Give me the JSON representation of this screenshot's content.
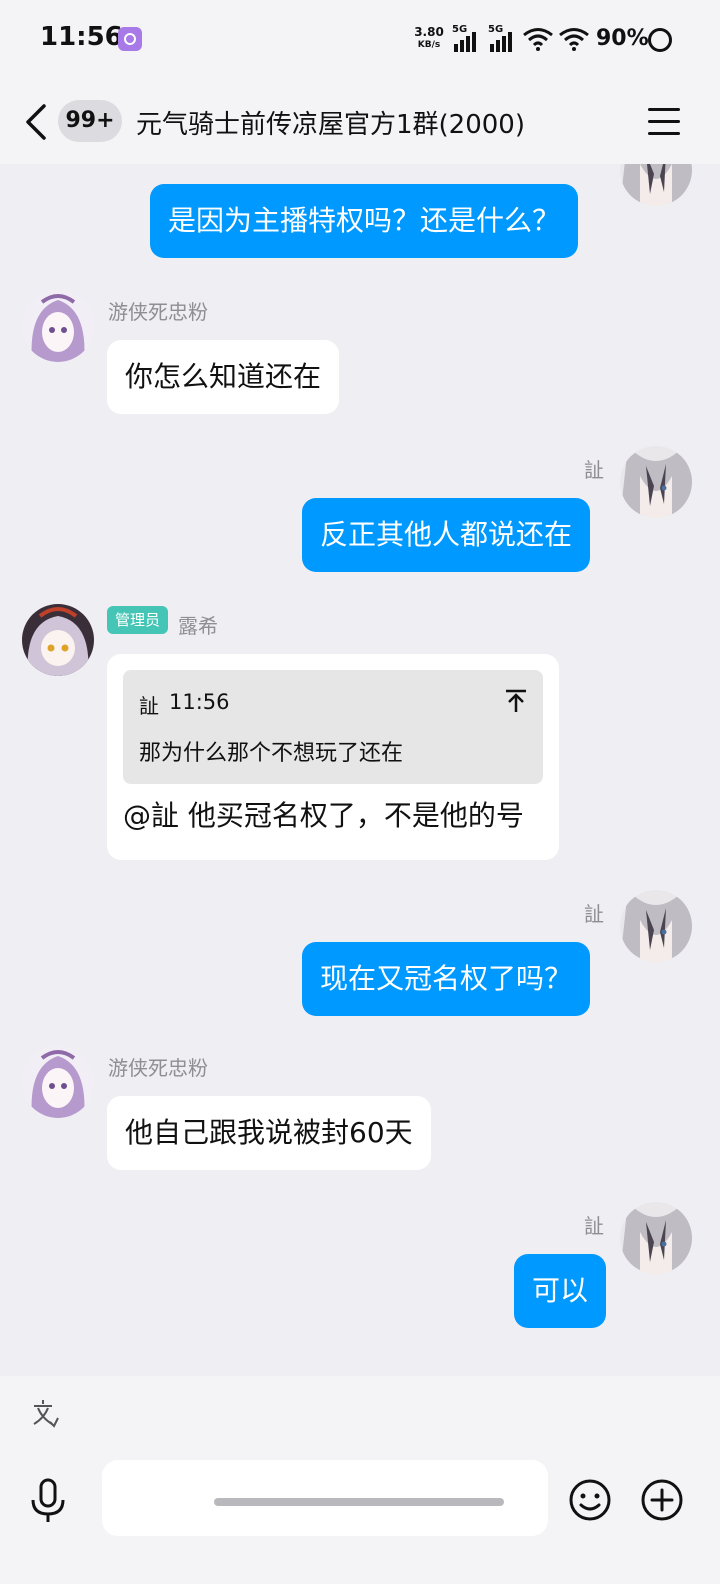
{
  "status_bar": {
    "time": "11:56",
    "net_speed": "3.80",
    "net_unit": "KB/s",
    "sim1": "5G",
    "sim2": "5G",
    "battery": "90%"
  },
  "header": {
    "unread": "99+",
    "title": "元气骑士前传凉屋官方1群(2000)"
  },
  "messages": [
    {
      "side": "me",
      "text": "是因为主播特权吗？还是什么？"
    },
    {
      "side": "them",
      "sender": "游侠死忠粉",
      "text": "你怎么知道还在"
    },
    {
      "side": "me",
      "sender": "訨",
      "text": "反正其他人都说还在"
    },
    {
      "side": "them",
      "sender": "露希",
      "role": "管理员",
      "quote": {
        "author": "訨",
        "time": "11:56",
        "text": "那为什么那个不想玩了还在"
      },
      "text": "@訨 他买冠名权了，不是他的号"
    },
    {
      "side": "me",
      "sender": "訨",
      "text": "现在又冠名权了吗？"
    },
    {
      "side": "them",
      "sender": "游侠死忠粉",
      "text": "他自己跟我说被封60天"
    },
    {
      "side": "me",
      "sender": "訨",
      "text": "可以"
    }
  ],
  "input": {
    "placeholder": ""
  },
  "colors": {
    "my_bubble": "#0099ff",
    "their_bubble": "#ffffff",
    "admin_tag": "#45c5b5",
    "background": "#efeff3"
  },
  "icons": [
    "back-icon",
    "menu-icon",
    "translate-icon",
    "mic-icon",
    "emoji-icon",
    "plus-icon",
    "jump-to-quote-icon"
  ]
}
